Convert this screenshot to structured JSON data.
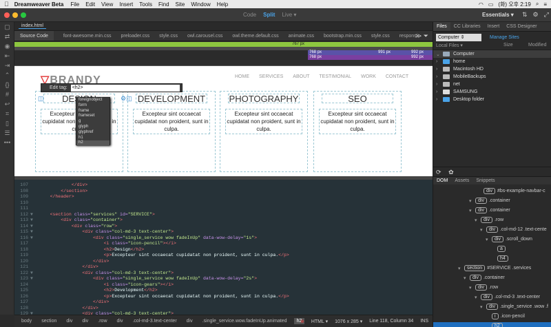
{
  "macbar": {
    "app": "Dreamweaver Beta",
    "menus": [
      "File",
      "Edit",
      "View",
      "Insert",
      "Tools",
      "Find",
      "Site",
      "Window",
      "Help"
    ],
    "time": "(화) 오후 2:19"
  },
  "window": {
    "views": [
      "Code",
      "Split",
      "Live"
    ],
    "active_view": "Split",
    "live_arrow": "▾",
    "workspace": "Essentials ▾",
    "doc_tab": "index.html"
  },
  "related_files": {
    "source": "Source Code",
    "files": [
      "font-awesome.min.css",
      "preloader.css",
      "style.css",
      "owl.carousel.css",
      "owl.theme.default.css",
      "animate.css",
      "bootstrap.min.css",
      "style.css",
      "responsi"
    ]
  },
  "media_queries": {
    "q1": "767 px",
    "q2_min": "768 px",
    "q2_max": "991 px",
    "q2_max2": "992 px",
    "q3_min": "768 px",
    "q3_max": "992 px"
  },
  "design": {
    "logo": "BRANDY",
    "nav": [
      "HOME",
      "SERVICES",
      "ABOUT",
      "TESTIMONIAL",
      "WORK",
      "CONTACT"
    ],
    "columns": [
      {
        "title": "DESIGN",
        "text": "Excepteur sint occaecat cupidatat non proident, sunt in culpa."
      },
      {
        "title": "DEVELOPMENT",
        "text": "Excepteur sint occaecat cupidatat non proident, sunt in culpa."
      },
      {
        "title": "PHOTOGRAPHY",
        "text": "Excepteur sint occaecat cupidatat non proident, sunt in culpa."
      },
      {
        "title": "SEO",
        "text": "Excepteur sint occaecat cupidatat non proident, sunt in culpa."
      }
    ]
  },
  "edit_tag": {
    "label": "Edit tag:",
    "value": "<h2>"
  },
  "autocomplete": [
    "foreignobject",
    "form",
    "frame",
    "frameset",
    "g",
    "glyph",
    "glyphref",
    "h1",
    "h2"
  ],
  "code_lines": [
    {
      "n": "107",
      "f": "",
      "parts": [
        [
          "tg",
          "            </div>"
        ]
      ]
    },
    {
      "n": "108",
      "f": "",
      "parts": [
        [
          "tg",
          "        </section>"
        ]
      ]
    },
    {
      "n": "109",
      "f": "",
      "parts": [
        [
          "tg",
          "    </header>"
        ]
      ]
    },
    {
      "n": "110",
      "f": "",
      "parts": []
    },
    {
      "n": "111",
      "f": "",
      "parts": []
    },
    {
      "n": "112",
      "f": "▼",
      "parts": [
        [
          "tg",
          "    <section "
        ],
        [
          "at",
          "class="
        ],
        [
          "st",
          "\"services\" "
        ],
        [
          "at",
          "id="
        ],
        [
          "st",
          "\"SERVICE\""
        ],
        [
          "tg",
          ">"
        ]
      ]
    },
    {
      "n": "113",
      "f": "▼",
      "parts": [
        [
          "tg",
          "        <div "
        ],
        [
          "at",
          "class="
        ],
        [
          "st",
          "\"container\""
        ],
        [
          "tg",
          ">"
        ]
      ]
    },
    {
      "n": "114",
      "f": "▼",
      "parts": [
        [
          "tg",
          "            <div "
        ],
        [
          "at",
          "class="
        ],
        [
          "st",
          "\"row\""
        ],
        [
          "tg",
          ">"
        ]
      ]
    },
    {
      "n": "115",
      "f": "▼",
      "parts": [
        [
          "tg",
          "                <div "
        ],
        [
          "at",
          "class="
        ],
        [
          "st",
          "\"col-md-3 text-center\""
        ],
        [
          "tg",
          ">"
        ]
      ]
    },
    {
      "n": "116",
      "f": "▼",
      "parts": [
        [
          "tg",
          "                    <div "
        ],
        [
          "at",
          "class="
        ],
        [
          "st",
          "\"single_service wow fadeInUp\" "
        ],
        [
          "at",
          "data-wow-delay="
        ],
        [
          "st",
          "\"1s\""
        ],
        [
          "tg",
          ">"
        ]
      ]
    },
    {
      "n": "117",
      "f": "",
      "parts": [
        [
          "tg",
          "                        <i "
        ],
        [
          "at",
          "class="
        ],
        [
          "st",
          "\"icon-pencil\""
        ],
        [
          "tg",
          "></i>"
        ]
      ]
    },
    {
      "n": "118",
      "f": "",
      "parts": [
        [
          "tg",
          "                        <h2>"
        ],
        [
          "tx",
          "Design"
        ],
        [
          "tg",
          "</h2>"
        ]
      ]
    },
    {
      "n": "119",
      "f": "",
      "parts": [
        [
          "tg",
          "                        <p>"
        ],
        [
          "tx",
          "Excepteur sint occaecat cupidatat non proident, sunt in culpa."
        ],
        [
          "tg",
          "</p>"
        ]
      ]
    },
    {
      "n": "120",
      "f": "",
      "parts": [
        [
          "tg",
          "                    </div>"
        ]
      ]
    },
    {
      "n": "121",
      "f": "",
      "parts": [
        [
          "tg",
          "                </div>"
        ]
      ]
    },
    {
      "n": "122",
      "f": "▼",
      "parts": [
        [
          "tg",
          "                <div "
        ],
        [
          "at",
          "class="
        ],
        [
          "st",
          "\"col-md-3 text-center\""
        ],
        [
          "tg",
          ">"
        ]
      ]
    },
    {
      "n": "123",
      "f": "▼",
      "parts": [
        [
          "tg",
          "                    <div "
        ],
        [
          "at",
          "class="
        ],
        [
          "st",
          "\"single_service wow fadeInUp\" "
        ],
        [
          "at",
          "data-wow-delay="
        ],
        [
          "st",
          "\"2s\""
        ],
        [
          "tg",
          ">"
        ]
      ]
    },
    {
      "n": "124",
      "f": "",
      "parts": [
        [
          "tg",
          "                        <i "
        ],
        [
          "at",
          "class="
        ],
        [
          "st",
          "\"icon-gears\""
        ],
        [
          "tg",
          "></i>"
        ]
      ]
    },
    {
      "n": "125",
      "f": "",
      "parts": [
        [
          "tg",
          "                        <h2>"
        ],
        [
          "tx",
          "Development"
        ],
        [
          "tg",
          "</h2>"
        ]
      ]
    },
    {
      "n": "126",
      "f": "",
      "parts": [
        [
          "tg",
          "                        <p>"
        ],
        [
          "tx",
          "Excepteur sint occaecat cupidatat non proident, sunt in culpa."
        ],
        [
          "tg",
          "</p>"
        ]
      ]
    },
    {
      "n": "127",
      "f": "",
      "parts": [
        [
          "tg",
          "                    </div>"
        ]
      ]
    },
    {
      "n": "128",
      "f": "",
      "parts": [
        [
          "tg",
          "                </div>"
        ]
      ]
    },
    {
      "n": "129",
      "f": "▼",
      "parts": [
        [
          "tg",
          "                <div "
        ],
        [
          "at",
          "class="
        ],
        [
          "st",
          "\"col-md-3 text-center\""
        ],
        [
          "tg",
          ">"
        ]
      ]
    }
  ],
  "status": {
    "crumbs": [
      "body",
      "section",
      "div",
      "div",
      ".row",
      "div",
      ".col-md-3.text-center",
      "div",
      ".single_service.wow.fadeInUp.animated",
      "h2"
    ],
    "lang": "HTML",
    "size": "1076 x 285",
    "cursor": "Line 118, Column 34",
    "mode": "INS"
  },
  "right_panel": {
    "tabs": [
      "Files",
      "CC Libraries",
      "Insert",
      "CSS Designer"
    ],
    "location": "Computer",
    "manage": "Manage Sites",
    "col_name": "Local Files ▾",
    "col_size": "Size",
    "col_mod": "Modified",
    "files": [
      {
        "name": "Computer",
        "color": "#9ab"
      },
      {
        "name": "home",
        "color": "#4aa3e8"
      },
      {
        "name": "Macintosh HD",
        "color": "#bbb"
      },
      {
        "name": "MobileBackups",
        "color": "#bbb"
      },
      {
        "name": "net",
        "color": "#bbb"
      },
      {
        "name": "SAMSUNG",
        "color": "#ddd"
      },
      {
        "name": "Desktop folder",
        "color": "#4aa3e8"
      }
    ],
    "dom_tabs": [
      "DOM",
      "Assets",
      "Snippets"
    ],
    "dom": [
      {
        "t": "#bs-example-navbar-c",
        "x": 64,
        "tw": "",
        "box": "div"
      },
      {
        "t": ".container",
        "x": 52,
        "tw": "▾",
        "box": "div"
      },
      {
        "t": ".container",
        "x": 52,
        "tw": "▾",
        "box": "div"
      },
      {
        "t": ".row",
        "x": 60,
        "tw": "▾",
        "box": "div"
      },
      {
        "t": ".col-md-12 .text-cente",
        "x": 68,
        "tw": "▾",
        "box": "div"
      },
      {
        "t": ".scroll_down",
        "x": 76,
        "tw": "▾",
        "box": "div"
      },
      {
        "t": "",
        "x": 84,
        "tw": "",
        "box": "a"
      },
      {
        "t": "",
        "x": 84,
        "tw": "",
        "box": "h4"
      },
      {
        "t": "#SERVICE .services",
        "x": 36,
        "tw": "▾",
        "box": "section"
      },
      {
        "t": ".container",
        "x": 44,
        "tw": "▾",
        "box": "div"
      },
      {
        "t": ".row",
        "x": 52,
        "tw": "▾",
        "box": "div"
      },
      {
        "t": ".col-md-3 .text-center",
        "x": 60,
        "tw": "▾",
        "box": "div"
      },
      {
        "t": ".single_service .wow .f",
        "x": 68,
        "tw": "▾",
        "box": "div"
      },
      {
        "t": ".icon-pencil",
        "x": 76,
        "tw": "",
        "box": "i"
      },
      {
        "t": "",
        "x": 76,
        "tw": "",
        "box": "h2"
      }
    ]
  }
}
